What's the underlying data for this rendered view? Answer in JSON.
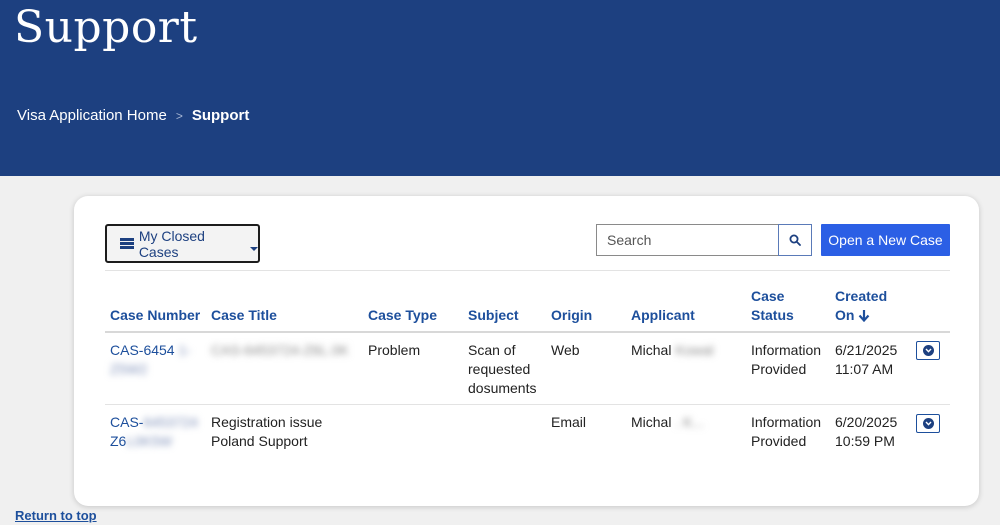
{
  "header": {
    "title": "Support",
    "breadcrumb": {
      "home": "Visa Application Home",
      "separator": ">",
      "current": "Support"
    }
  },
  "toolbar": {
    "view_label": "My Closed Cases",
    "search_placeholder": "Search",
    "new_case_label": "Open a New Case"
  },
  "table": {
    "columns": {
      "case_number": "Case Number",
      "case_title": "Case Title",
      "case_type": "Case Type",
      "subject": "Subject",
      "origin": "Origin",
      "applicant": "Applicant",
      "case_status_l1": "Case",
      "case_status_l2": "Status",
      "created_l1": "Created",
      "created_l2": "On"
    },
    "rows": [
      {
        "case_number_l1": "CAS-6454",
        "case_number_redacted_l1": "1-",
        "case_number_l2": "Z5W2",
        "case_title": "CAS-6453724-Z6L.0K",
        "case_type": "Problem",
        "subject_l1": "Scan of",
        "subject_l2": "requested",
        "subject_l3": "dosuments",
        "origin": "Web",
        "applicant": "Michal",
        "applicant_redacted": "Kowal",
        "status_l1": "Information",
        "status_l2": "Provided",
        "created_date": "6/21/2025",
        "created_time": "11:07 AM"
      },
      {
        "case_number_l1": "CAS-",
        "case_number_redacted_l1": "6453724",
        "case_number_l2": "Z6",
        "case_number_redacted_l2": "L0K5W",
        "case_title_l1": "Registration issue",
        "case_title_l2": "Poland Support",
        "case_type": "",
        "subject": "",
        "origin": "Email",
        "applicant": "Michal",
        "applicant_redacted": ". K...",
        "status_l1": "Information",
        "status_l2": "Provided",
        "created_date": "6/20/2025",
        "created_time": "10:59 PM"
      }
    ]
  },
  "footer": {
    "return_to_top": "Return to top"
  },
  "colors": {
    "banner": "#1d4080",
    "link": "#1d4f9c",
    "primary_button": "#2b5fe5"
  },
  "icons": {
    "view": "list-icon",
    "dropdown": "caret-down-icon",
    "search": "search-icon",
    "sort": "arrow-down-icon",
    "row_action": "chevron-down-circle-icon"
  }
}
